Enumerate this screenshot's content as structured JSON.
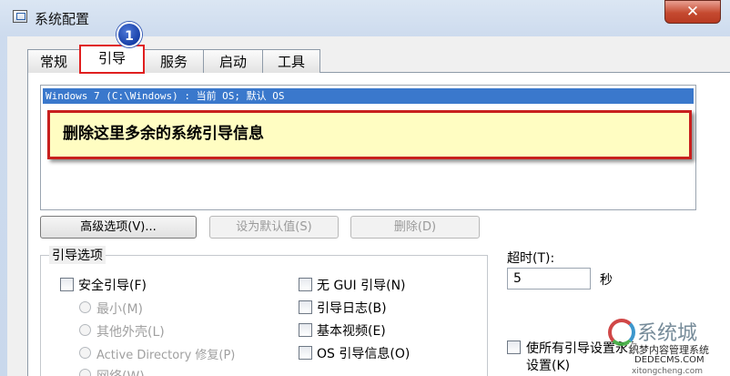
{
  "window": {
    "title": "系统配置",
    "close_glyph": "✕"
  },
  "tabs": [
    {
      "label": "常规"
    },
    {
      "label": "引导"
    },
    {
      "label": "服务"
    },
    {
      "label": "启动"
    },
    {
      "label": "工具"
    }
  ],
  "step_marker": "1",
  "boot_list": {
    "items": [
      "Windows 7 (C:\\Windows) : 当前 OS; 默认 OS"
    ]
  },
  "callout": "删除这里多余的系统引导信息",
  "buttons": {
    "advanced": "高级选项(V)...",
    "set_default": "设为默认值(S)",
    "delete": "删除(D)"
  },
  "boot_options": {
    "title": "引导选项",
    "safe_boot": "安全引导(F)",
    "minimal": "最小(M)",
    "alternate_shell": "其他外壳(L)",
    "active_directory": "Active Directory 修复(P)",
    "network": "网络(W)",
    "no_gui": "无 GUI 引导(N)",
    "boot_log": "引导日志(B)",
    "base_video": "基本视频(E)",
    "os_boot_info": "OS 引导信息(O)"
  },
  "timeout": {
    "label": "超时(T):",
    "value": "5",
    "unit": "秒"
  },
  "make_permanent": "使所有引导设置永久",
  "make_permanent_2": "设置(K)",
  "watermark": {
    "main": "系统城",
    "line1": "织梦内容管理系统",
    "line2": "DEDECMS.COM",
    "line3": "xitongcheng.com"
  }
}
